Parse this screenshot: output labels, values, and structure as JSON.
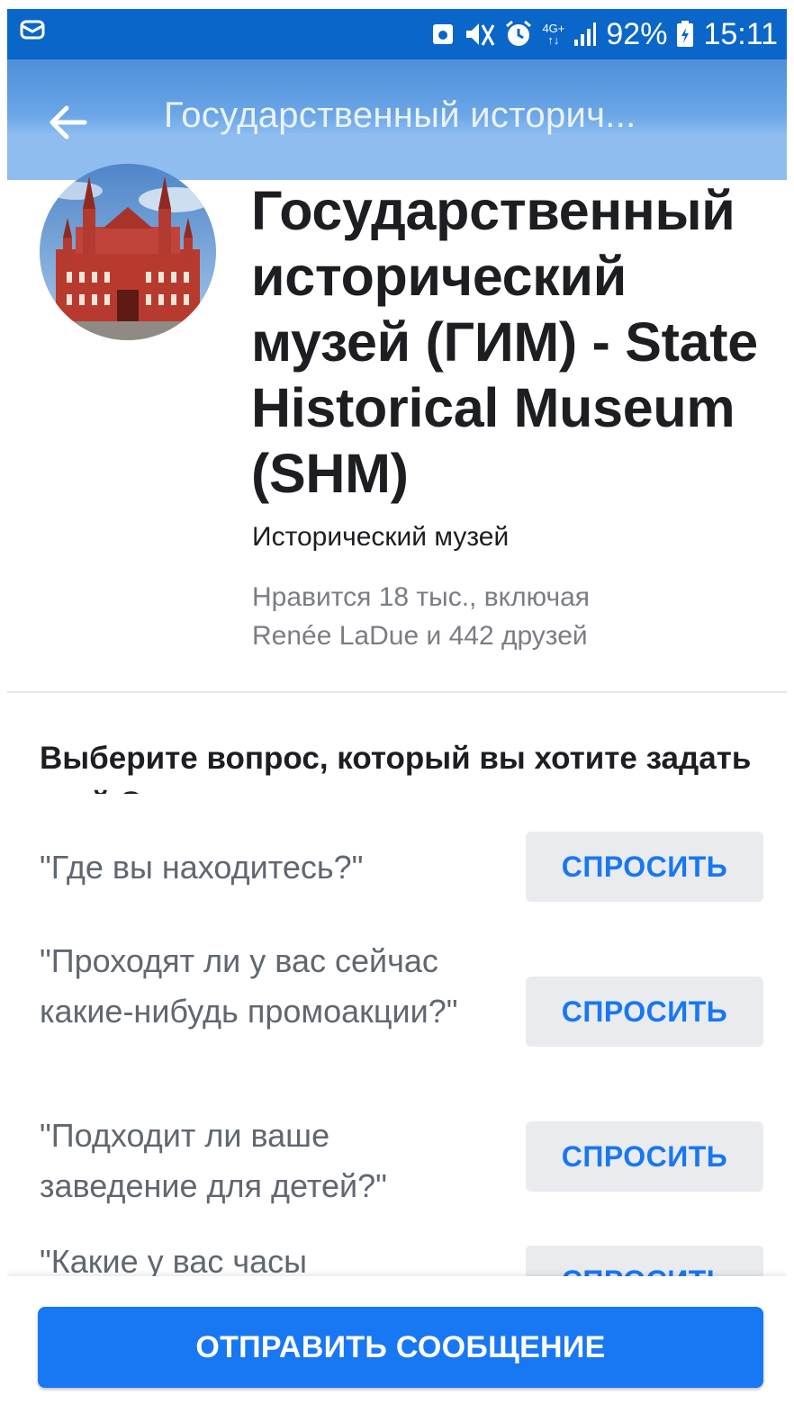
{
  "status_bar": {
    "battery": "92%",
    "time": "15:11",
    "network": "4G+",
    "icons": [
      "message-icon",
      "photo-icon",
      "mute-icon",
      "alarm-icon",
      "network-icon",
      "signal-icon",
      "battery-icon"
    ]
  },
  "app_bar": {
    "title": "Государственный историч..."
  },
  "page": {
    "name": "Государственный исторический музей (ГИМ) - State Historical Museum (SHM)",
    "category": "Исторический музей",
    "likes_line1": "Нравится 18 тыс., включая",
    "likes_line2": "Renée LaDue и 442 друзей"
  },
  "questions": {
    "heading": "Выберите вопрос, который вы хотите задать этой Странице",
    "ask_label": "СПРОСИТЬ",
    "items": [
      "\"Где вы находитесь?\"",
      "\"Проходят ли у вас сейчас какие-нибудь промоакции?\"",
      "\"Подходит ли ваше заведение для детей?\"",
      "\"Какие у вас часы"
    ]
  },
  "send_button": "ОТПРАВИТЬ СООБЩЕНИЕ",
  "colors": {
    "status_bar": "#0a66c8",
    "app_bar": "#6aa5e6",
    "accent": "#1877f2",
    "button_bg": "#e9ebee"
  }
}
